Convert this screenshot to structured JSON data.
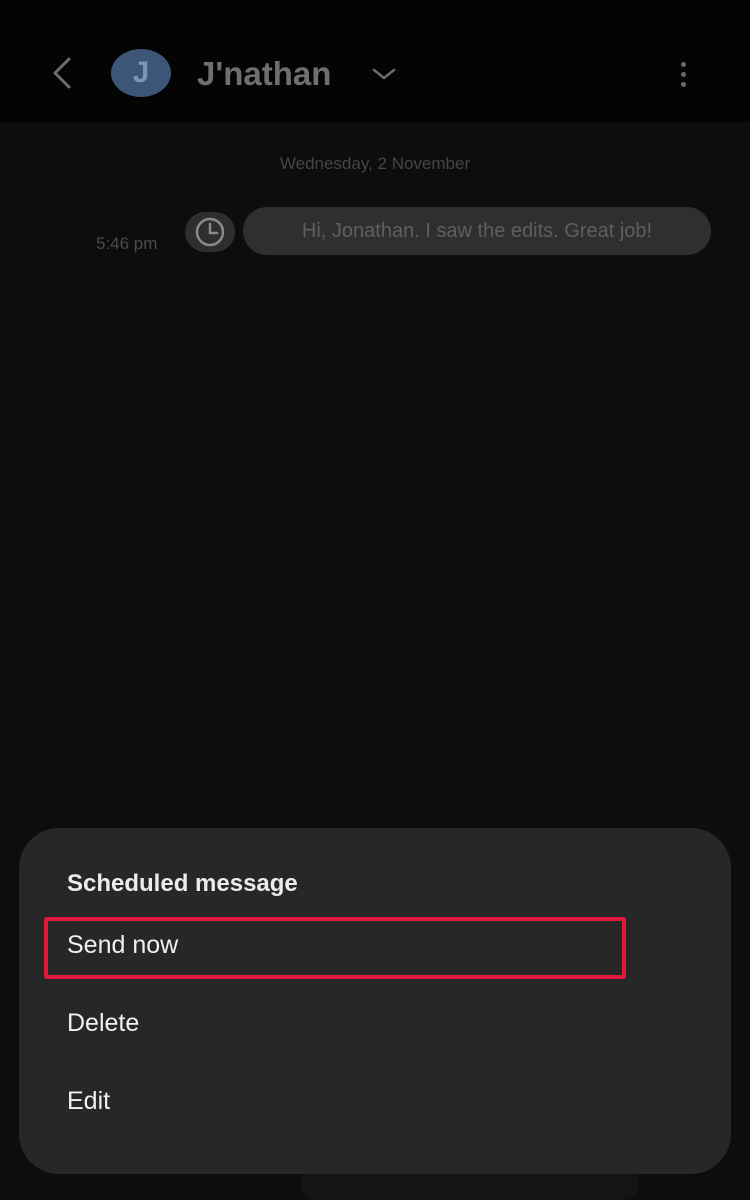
{
  "header": {
    "avatar_initial": "J",
    "contact_name": "J'nathan",
    "icons": [
      "back-arrow-icon",
      "chevron-down-icon",
      "more-options-icon"
    ]
  },
  "conversation": {
    "date_label": "Wednesday, 2 November",
    "message": {
      "time": "5:46 pm",
      "text": "Hi, Jonathan. I saw the edits. Great job!",
      "status_icon": "clock-icon"
    }
  },
  "sheet": {
    "title": "Scheduled message",
    "items": [
      {
        "label": "Send now",
        "highlighted": true
      },
      {
        "label": "Delete"
      },
      {
        "label": "Edit"
      }
    ]
  },
  "colors": {
    "background": "#0d0d0d",
    "sheet": "#272727",
    "avatar": "#3d5577",
    "highlight": "#e01a3a"
  }
}
